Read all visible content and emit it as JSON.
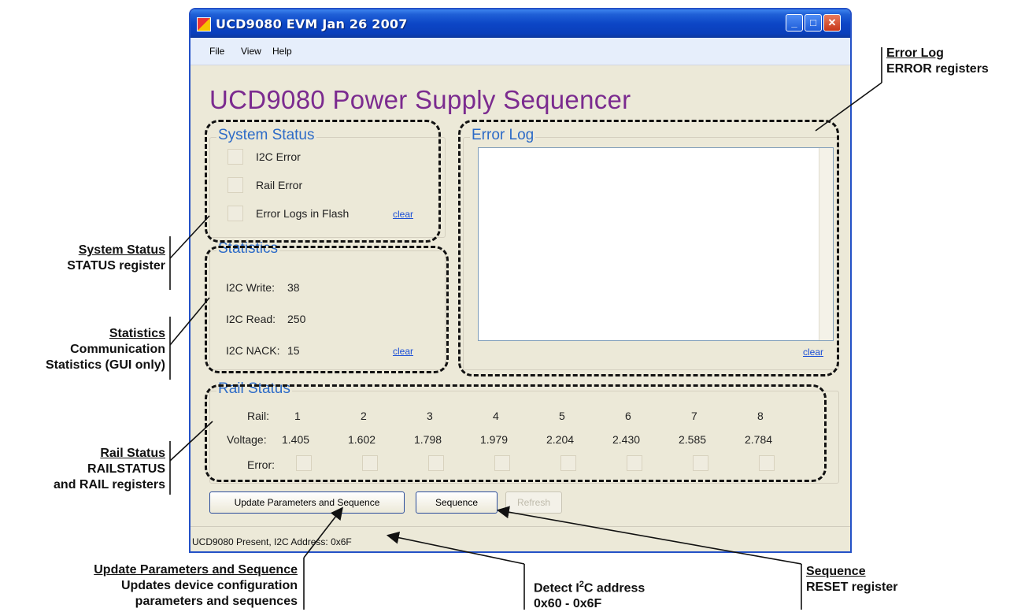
{
  "window": {
    "title": "UCD9080 EVM Jan 26 2007",
    "menu": [
      "File",
      "View",
      "Help"
    ],
    "heading": "UCD9080 Power Supply Sequencer"
  },
  "system_status": {
    "title": "System Status",
    "items": [
      "I2C Error",
      "Rail Error",
      "Error Logs in Flash"
    ],
    "clear_label": "clear"
  },
  "statistics": {
    "title": "Statistics",
    "rows": [
      {
        "label": "I2C Write:",
        "value": "38"
      },
      {
        "label": "I2C Read:",
        "value": "250"
      },
      {
        "label": "I2C NACK:",
        "value": "15"
      }
    ],
    "clear_label": "clear"
  },
  "error_log": {
    "title": "Error Log",
    "content": "",
    "clear_label": "clear"
  },
  "rail_status": {
    "title": "Rail Status",
    "rail_label": "Rail:",
    "voltage_label": "Voltage:",
    "error_label": "Error:",
    "rails": [
      "1",
      "2",
      "3",
      "4",
      "5",
      "6",
      "7",
      "8"
    ],
    "voltages": [
      "1.405",
      "1.602",
      "1.798",
      "1.979",
      "2.204",
      "2.430",
      "2.585",
      "2.784"
    ]
  },
  "buttons": {
    "update": "Update Parameters and Sequence",
    "sequence": "Sequence",
    "refresh": "Refresh"
  },
  "status_bar": {
    "text": "UCD9080 Present, I2C Address: 0x6F"
  },
  "annotations": {
    "error_log": {
      "title": "Error Log",
      "desc": "ERROR registers"
    },
    "system_status": {
      "title": "System Status",
      "desc": "STATUS register"
    },
    "statistics": {
      "title": "Statistics",
      "desc1": "Communication",
      "desc2": "Statistics (GUI only)"
    },
    "rail_status": {
      "title": "Rail Status",
      "desc1": "RAILSTATUS",
      "desc2": "and RAIL registers"
    },
    "update": {
      "title": "Update Parameters and Sequence",
      "desc1": "Updates device configuration",
      "desc2": "parameters and sequences"
    },
    "detect": {
      "title_pre": "Detect I",
      "title_sup": "2",
      "title_post": "C address",
      "desc": "0x60 - 0x6F"
    },
    "sequence": {
      "title": "Sequence",
      "desc": "RESET register"
    }
  }
}
